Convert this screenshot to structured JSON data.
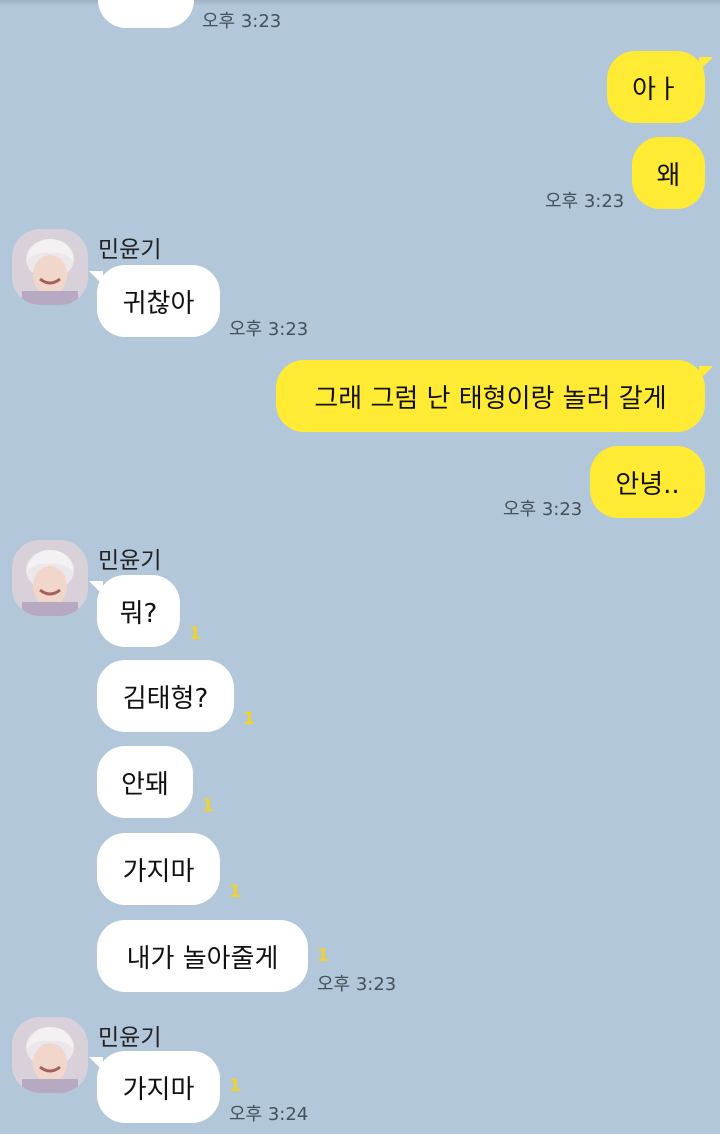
{
  "sender_name": "민윤기",
  "unread_mark": "1",
  "colors": {
    "background": "#b2c7d9",
    "incoming": "#ffffff",
    "outgoing": "#ffeb33",
    "unread": "#f0d22b"
  },
  "messages": [
    {
      "id": "m0",
      "dir": "in",
      "text": "",
      "time": "오후 3:23"
    },
    {
      "id": "m1",
      "dir": "out",
      "text": "아ㅏ"
    },
    {
      "id": "m2",
      "dir": "out",
      "text": "왜",
      "time": "오후 3:23"
    },
    {
      "id": "m3",
      "dir": "in",
      "sender": "민윤기",
      "text": "귀찮아",
      "time": "오후 3:23"
    },
    {
      "id": "m4",
      "dir": "out",
      "text": "그래 그럼 난 태형이랑 놀러 갈게"
    },
    {
      "id": "m5",
      "dir": "out",
      "text": "안녕..",
      "time": "오후 3:23"
    },
    {
      "id": "m6",
      "dir": "in",
      "sender": "민윤기",
      "text": "뭐?",
      "unread": "1"
    },
    {
      "id": "m7",
      "dir": "in",
      "text": "김태형?",
      "unread": "1"
    },
    {
      "id": "m8",
      "dir": "in",
      "text": "안돼",
      "unread": "1"
    },
    {
      "id": "m9",
      "dir": "in",
      "text": "가지마",
      "unread": "1"
    },
    {
      "id": "m10",
      "dir": "in",
      "text": "내가 놀아줄게",
      "unread": "1",
      "time": "오후 3:23"
    },
    {
      "id": "m11",
      "dir": "in",
      "sender": "민윤기",
      "text": "가지마",
      "unread": "1",
      "time": "오후 3:24"
    }
  ]
}
